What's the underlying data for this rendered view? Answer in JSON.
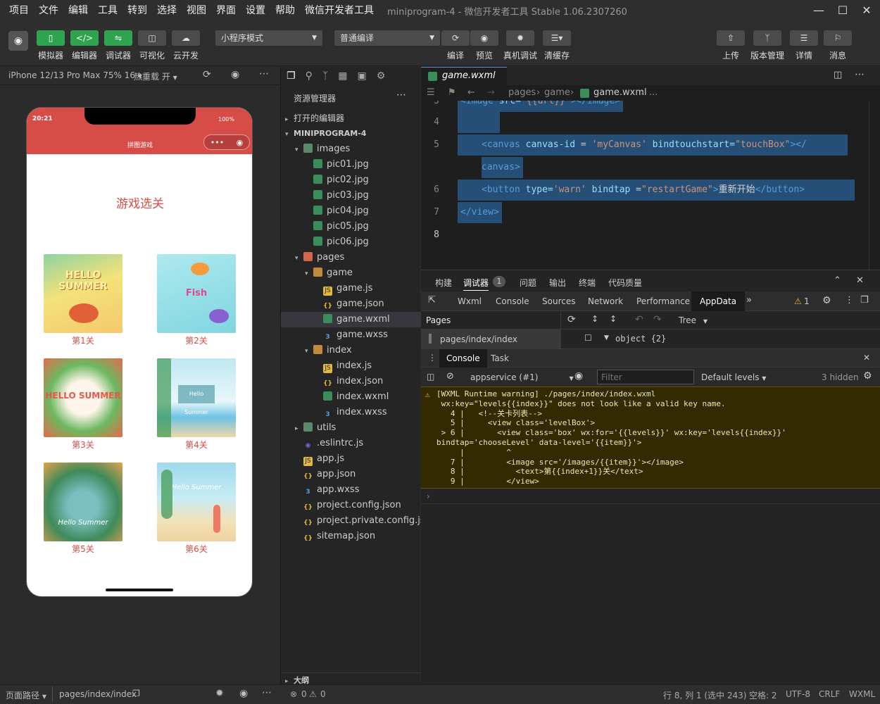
{
  "menu": [
    "项目",
    "文件",
    "编辑",
    "工具",
    "转到",
    "选择",
    "视图",
    "界面",
    "设置",
    "帮助",
    "微信开发者工具"
  ],
  "window_title": "miniprogram-4 - 微信开发者工具 Stable 1.06.2307260",
  "toolbar": {
    "simulator": "模拟器",
    "editor": "编辑器",
    "debugger": "调试器",
    "visual": "可视化",
    "cloud": "云开发",
    "mode": "小程序模式",
    "compile_mode": "普通编译",
    "compile": "编译",
    "preview": "预览",
    "real_debug": "真机调试",
    "clear_cache": "清缓存",
    "upload": "上传",
    "version": "版本管理",
    "details": "详情",
    "messages": "消息"
  },
  "sim": {
    "device": "iPhone 12/13 Pro Max 75% 16",
    "hotreload": "热重载 开",
    "time": "20:21",
    "battery": "100%",
    "nav_title": "拼图游戏",
    "page_heading": "游戏选关",
    "levels": [
      "第1关",
      "第2关",
      "第3关",
      "第4关",
      "第5关",
      "第6关"
    ],
    "card_texts": [
      "HELLO SUMMER",
      "Fish",
      "HELLO SUMMER",
      "Hello Summer",
      "Hello Summer",
      "Hello Summer"
    ],
    "path_label": "页面路径",
    "path": "pages/index/index"
  },
  "explorer": {
    "title": "资源管理器",
    "open_editors": "打开的编辑器",
    "project": "MINIPROGRAM-4",
    "items": [
      {
        "name": "images",
        "type": "folderg",
        "depth": 1,
        "arrow": "▾"
      },
      {
        "name": "pic01.jpg",
        "type": "img",
        "depth": 2
      },
      {
        "name": "pic02.jpg",
        "type": "img",
        "depth": 2
      },
      {
        "name": "pic03.jpg",
        "type": "img",
        "depth": 2
      },
      {
        "name": "pic04.jpg",
        "type": "img",
        "depth": 2
      },
      {
        "name": "pic05.jpg",
        "type": "img",
        "depth": 2
      },
      {
        "name": "pic06.jpg",
        "type": "img",
        "depth": 2
      },
      {
        "name": "pages",
        "type": "foldr",
        "depth": 1,
        "arrow": "▾"
      },
      {
        "name": "game",
        "type": "folder",
        "depth": 2,
        "arrow": "▾"
      },
      {
        "name": "game.js",
        "type": "js",
        "depth": 3
      },
      {
        "name": "game.json",
        "type": "json",
        "depth": 3
      },
      {
        "name": "game.wxml",
        "type": "wxml",
        "depth": 3,
        "selected": true
      },
      {
        "name": "game.wxss",
        "type": "wxss",
        "depth": 3
      },
      {
        "name": "index",
        "type": "folder",
        "depth": 2,
        "arrow": "▾"
      },
      {
        "name": "index.js",
        "type": "js",
        "depth": 3
      },
      {
        "name": "index.json",
        "type": "json",
        "depth": 3
      },
      {
        "name": "index.wxml",
        "type": "wxml",
        "depth": 3
      },
      {
        "name": "index.wxss",
        "type": "wxss",
        "depth": 3
      },
      {
        "name": "utils",
        "type": "folderg",
        "depth": 1,
        "arrow": "▸"
      },
      {
        "name": ".eslintrc.js",
        "type": "eslint",
        "depth": 1
      },
      {
        "name": "app.js",
        "type": "js",
        "depth": 1
      },
      {
        "name": "app.json",
        "type": "json",
        "depth": 1
      },
      {
        "name": "app.wxss",
        "type": "wxss",
        "depth": 1
      },
      {
        "name": "project.config.json",
        "type": "json",
        "depth": 1
      },
      {
        "name": "project.private.config.js...",
        "type": "json",
        "depth": 1
      },
      {
        "name": "sitemap.json",
        "type": "json",
        "depth": 1
      }
    ],
    "outline": "大纲",
    "errors": "0",
    "warnings": "0"
  },
  "editor": {
    "tab": "game.wxml",
    "crumbs": [
      "pages",
      "game",
      "game.wxml",
      "..."
    ]
  },
  "devtools": {
    "tabs": [
      "构建",
      "调试器",
      "问题",
      "输出",
      "终端",
      "代码质量"
    ],
    "debugger_badge": "1",
    "subtabs": [
      "Wxml",
      "Console",
      "Sources",
      "Network",
      "Performance",
      "AppData"
    ],
    "warn_count": "1",
    "pages_label": "Pages",
    "page_item": "pages/index/index",
    "tree_label": "Tree",
    "object_label": "object {2}",
    "console_tabs": [
      "Console",
      "Task"
    ],
    "context": "appservice (#1)",
    "filter_placeholder": "Filter",
    "levels": "Default levels",
    "hidden": "3 hidden",
    "warning": "[WXML Runtime warning] ./pages/index/index.wxml\n wx:key=\"levels{{index}}\" does not look like a valid key name.\n   4 |   <!--关卡列表-->\n   5 |     <view class='levelBox'>\n > 6 |       <view class='box' wx:for='{{levels}}' wx:key='levels{{index}}'\nbindtap='chooseLevel' data-level='{{item}}'>\n     |         ^\n   7 |         <image src='/images/{{item}}'></image>\n   8 |           <text>第{{index+1}}关</text>\n   9 |         </view>"
  },
  "status": {
    "position": "行 8, 列 1 (选中 243)",
    "spaces": "空格: 2",
    "encoding": "UTF-8",
    "eol": "CRLF",
    "lang": "WXML"
  }
}
